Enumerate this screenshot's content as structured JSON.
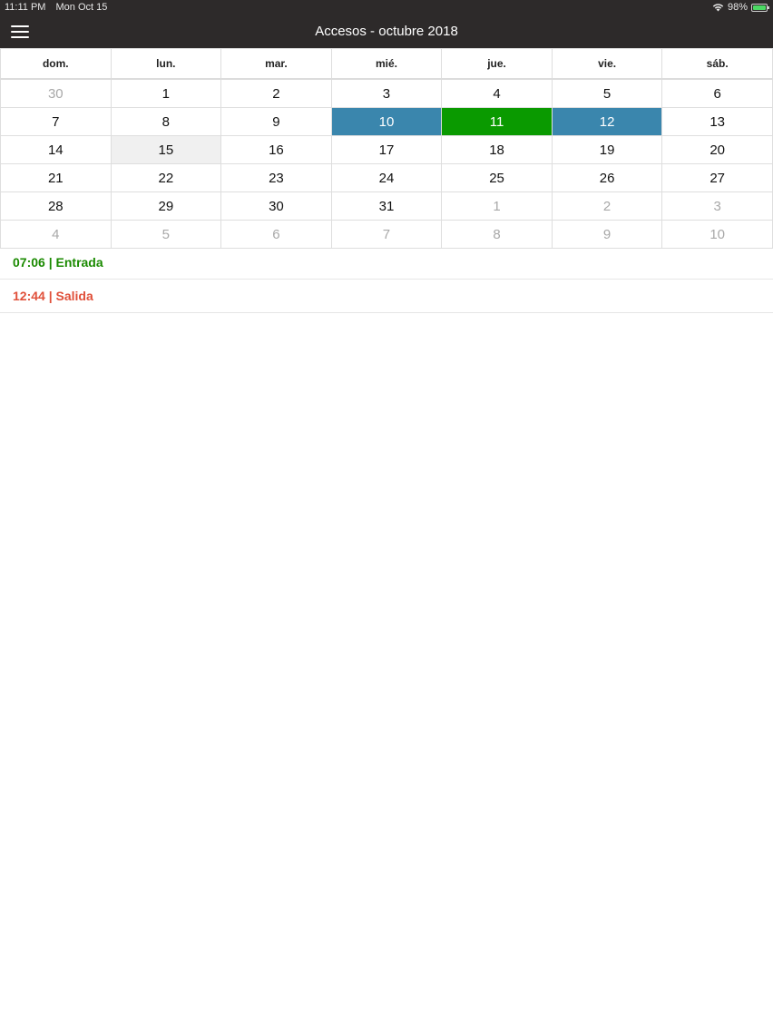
{
  "status": {
    "time": "11:11 PM",
    "date": "Mon Oct 15",
    "battery": "98%",
    "battery_color": "#4cd964"
  },
  "nav": {
    "title": "Accesos - octubre 2018",
    "menu_icon": "hamburger-menu-icon",
    "bar_color": "#2d2a2a"
  },
  "calendar": {
    "weekdays": [
      "dom.",
      "lun.",
      "mar.",
      "mié.",
      "jue.",
      "vie.",
      "sáb."
    ],
    "weeks": [
      [
        {
          "d": "30",
          "other": true
        },
        {
          "d": "1"
        },
        {
          "d": "2"
        },
        {
          "d": "3"
        },
        {
          "d": "4"
        },
        {
          "d": "5"
        },
        {
          "d": "6"
        }
      ],
      [
        {
          "d": "7"
        },
        {
          "d": "8"
        },
        {
          "d": "9"
        },
        {
          "d": "10",
          "state": "sel-blue"
        },
        {
          "d": "11",
          "state": "sel-green"
        },
        {
          "d": "12",
          "state": "sel-blue"
        },
        {
          "d": "13"
        }
      ],
      [
        {
          "d": "14"
        },
        {
          "d": "15",
          "state": "today"
        },
        {
          "d": "16"
        },
        {
          "d": "17"
        },
        {
          "d": "18"
        },
        {
          "d": "19"
        },
        {
          "d": "20"
        }
      ],
      [
        {
          "d": "21"
        },
        {
          "d": "22"
        },
        {
          "d": "23"
        },
        {
          "d": "24"
        },
        {
          "d": "25"
        },
        {
          "d": "26"
        },
        {
          "d": "27"
        }
      ],
      [
        {
          "d": "28"
        },
        {
          "d": "29"
        },
        {
          "d": "30"
        },
        {
          "d": "31"
        },
        {
          "d": "1",
          "other": true
        },
        {
          "d": "2",
          "other": true
        },
        {
          "d": "3",
          "other": true
        }
      ],
      [
        {
          "d": "4",
          "other": true
        },
        {
          "d": "5",
          "other": true
        },
        {
          "d": "6",
          "other": true
        },
        {
          "d": "7",
          "other": true
        },
        {
          "d": "8",
          "other": true
        },
        {
          "d": "9",
          "other": true
        },
        {
          "d": "10",
          "other": true
        }
      ]
    ],
    "colors": {
      "selected_blue": "#3a86ad",
      "selected_green": "#0a9a00",
      "today_bg": "#f0f0f0"
    }
  },
  "events": [
    {
      "time": "07:06",
      "label": "Entrada",
      "color": "#1a8a00"
    },
    {
      "time": "12:44",
      "label": "Salida",
      "color": "#e0503a"
    }
  ]
}
